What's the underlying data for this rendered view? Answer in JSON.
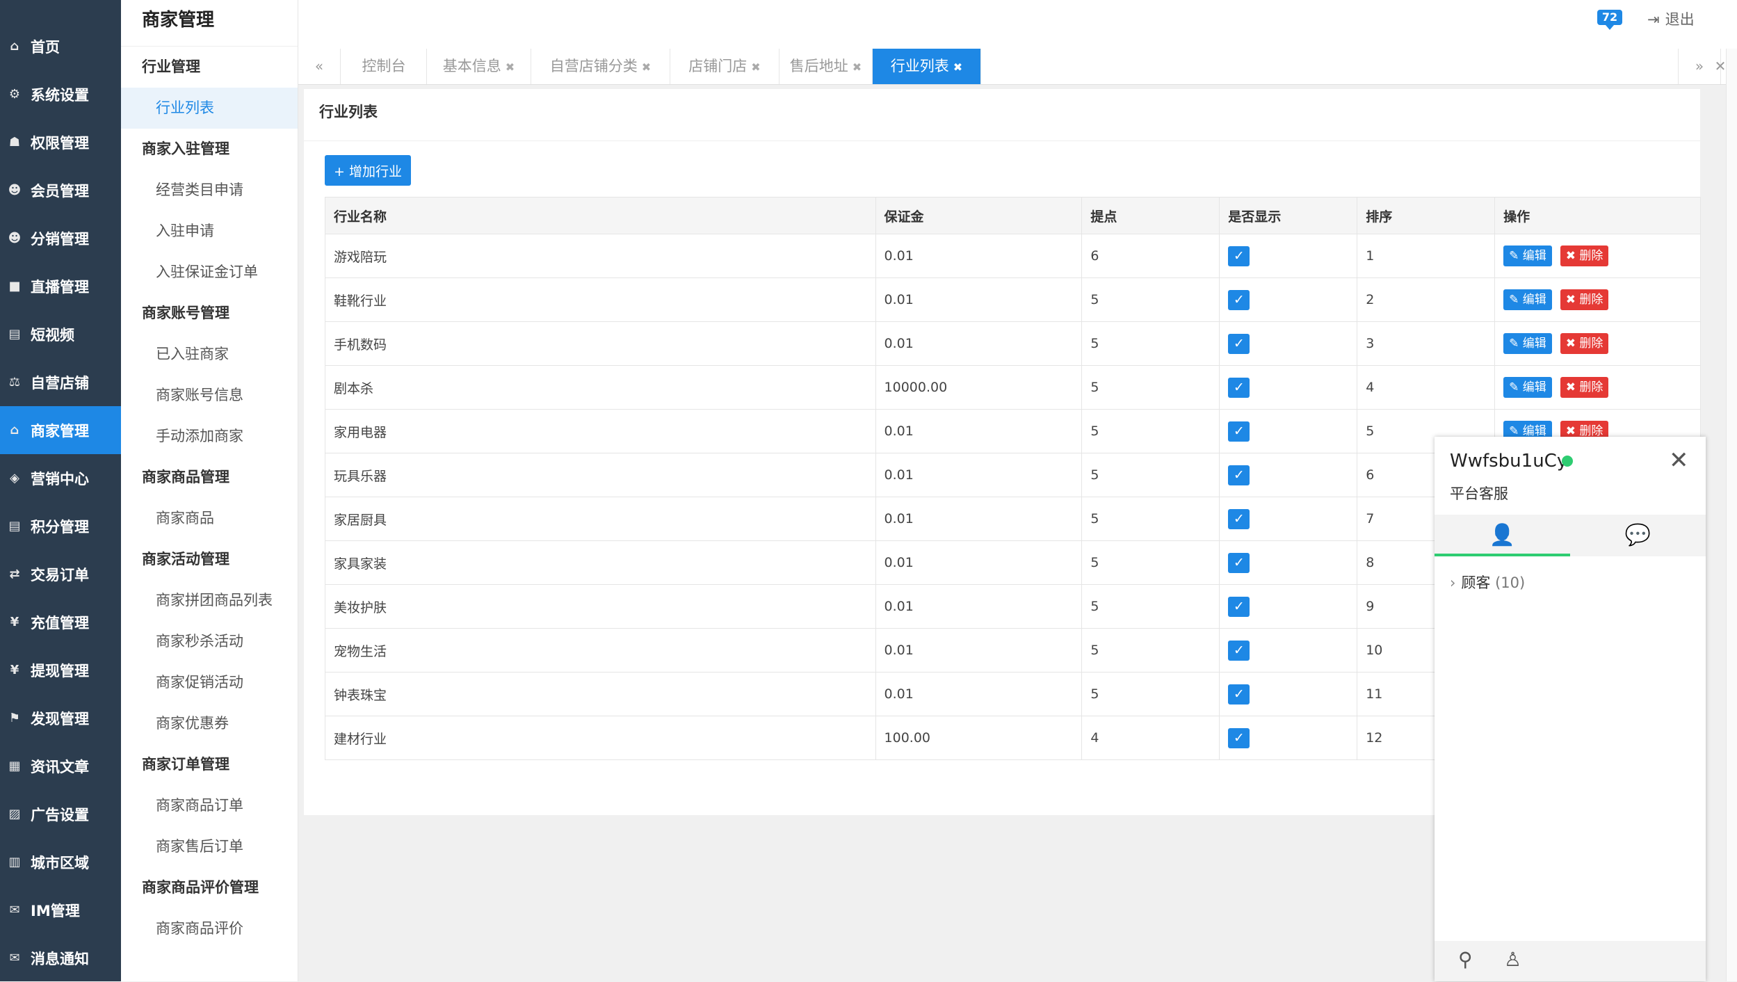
{
  "sidebar": {
    "items": [
      {
        "icon": "home-icon",
        "glyph": "⌂",
        "label": "首页"
      },
      {
        "icon": "gear-icon",
        "glyph": "⚙",
        "label": "系统设置"
      },
      {
        "icon": "sitemap-icon",
        "glyph": "☗",
        "label": "权限管理"
      },
      {
        "icon": "users-icon",
        "glyph": "☻",
        "label": "会员管理"
      },
      {
        "icon": "users-icon",
        "glyph": "☻",
        "label": "分销管理"
      },
      {
        "icon": "video-icon",
        "glyph": "■",
        "label": "直播管理"
      },
      {
        "icon": "file-icon",
        "glyph": "▤",
        "label": "短视频"
      },
      {
        "icon": "scale-icon",
        "glyph": "⚖",
        "label": "自营店铺"
      },
      {
        "icon": "bank-icon",
        "glyph": "⌂",
        "label": "商家管理"
      },
      {
        "icon": "tag-icon",
        "glyph": "◈",
        "label": "营销中心"
      },
      {
        "icon": "file-icon",
        "glyph": "▤",
        "label": "积分管理"
      },
      {
        "icon": "exchange-icon",
        "glyph": "⇄",
        "label": "交易订单"
      },
      {
        "icon": "yen-icon",
        "glyph": "¥",
        "label": "充值管理"
      },
      {
        "icon": "yen-icon",
        "glyph": "¥",
        "label": "提现管理"
      },
      {
        "icon": "flag-icon",
        "glyph": "⚑",
        "label": "发现管理"
      },
      {
        "icon": "newspaper-icon",
        "glyph": "▦",
        "label": "资讯文章"
      },
      {
        "icon": "image-icon",
        "glyph": "▨",
        "label": "广告设置"
      },
      {
        "icon": "map-icon",
        "glyph": "▥",
        "label": "城市区域"
      },
      {
        "icon": "chat-icon",
        "glyph": "✉",
        "label": "IM管理"
      },
      {
        "icon": "comment-icon",
        "glyph": "✉",
        "label": "消息通知"
      }
    ]
  },
  "submenu": {
    "title": "商家管理",
    "entries": [
      {
        "type": "group",
        "label": "行业管理"
      },
      {
        "type": "item",
        "label": "行业列表",
        "active": true
      },
      {
        "type": "group",
        "label": "商家入驻管理"
      },
      {
        "type": "item",
        "label": "经营类目申请"
      },
      {
        "type": "item",
        "label": "入驻申请"
      },
      {
        "type": "item",
        "label": "入驻保证金订单"
      },
      {
        "type": "group",
        "label": "商家账号管理"
      },
      {
        "type": "item",
        "label": "已入驻商家"
      },
      {
        "type": "item",
        "label": "商家账号信息"
      },
      {
        "type": "item",
        "label": "手动添加商家"
      },
      {
        "type": "group",
        "label": "商家商品管理"
      },
      {
        "type": "item",
        "label": "商家商品"
      },
      {
        "type": "group",
        "label": "商家活动管理"
      },
      {
        "type": "item",
        "label": "商家拼团商品列表"
      },
      {
        "type": "item",
        "label": "商家秒杀活动"
      },
      {
        "type": "item",
        "label": "商家促销活动"
      },
      {
        "type": "item",
        "label": "商家优惠券"
      },
      {
        "type": "group",
        "label": "商家订单管理"
      },
      {
        "type": "item",
        "label": "商家商品订单"
      },
      {
        "type": "item",
        "label": "商家售后订单"
      },
      {
        "type": "group",
        "label": "商家商品评价管理"
      },
      {
        "type": "item",
        "label": "商家商品评价"
      }
    ]
  },
  "header": {
    "notification_count": "72",
    "logout_label": "退出"
  },
  "tabs": {
    "items": [
      {
        "label": "控制台",
        "closable": false
      },
      {
        "label": "基本信息",
        "closable": true
      },
      {
        "label": "自营店铺分类",
        "closable": true
      },
      {
        "label": "店铺门店",
        "closable": true
      },
      {
        "label": "售后地址",
        "closable": true
      },
      {
        "label": "行业列表",
        "closable": true,
        "active": true
      }
    ]
  },
  "panel": {
    "title": "行业列表",
    "add_button": "+ 增加行业",
    "columns": [
      "行业名称",
      "保证金",
      "提点",
      "是否显示",
      "排序",
      "操作"
    ],
    "edit_label": "编辑",
    "delete_label": "删除",
    "rows": [
      {
        "name": "游戏陪玩",
        "deposit": "0.01",
        "commission": "6",
        "visible": true,
        "sort": "1"
      },
      {
        "name": "鞋靴行业",
        "deposit": "0.01",
        "commission": "5",
        "visible": true,
        "sort": "2"
      },
      {
        "name": "手机数码",
        "deposit": "0.01",
        "commission": "5",
        "visible": true,
        "sort": "3"
      },
      {
        "name": "剧本杀",
        "deposit": "10000.00",
        "commission": "5",
        "visible": true,
        "sort": "4"
      },
      {
        "name": "家用电器",
        "deposit": "0.01",
        "commission": "5",
        "visible": true,
        "sort": "5"
      },
      {
        "name": "玩具乐器",
        "deposit": "0.01",
        "commission": "5",
        "visible": true,
        "sort": "6"
      },
      {
        "name": "家居厨具",
        "deposit": "0.01",
        "commission": "5",
        "visible": true,
        "sort": "7"
      },
      {
        "name": "家具家装",
        "deposit": "0.01",
        "commission": "5",
        "visible": true,
        "sort": "8"
      },
      {
        "name": "美妆护肤",
        "deposit": "0.01",
        "commission": "5",
        "visible": true,
        "sort": "9"
      },
      {
        "name": "宠物生活",
        "deposit": "0.01",
        "commission": "5",
        "visible": true,
        "sort": "10"
      },
      {
        "name": "钟表珠宝",
        "deposit": "0.01",
        "commission": "5",
        "visible": true,
        "sort": "11"
      },
      {
        "name": "建材行业",
        "deposit": "100.00",
        "commission": "4",
        "visible": true,
        "sort": "12"
      }
    ]
  },
  "chat": {
    "username": "Wwfsbu1uCy",
    "role": "平台客服",
    "group_label": "顾客",
    "group_count": "(10)"
  },
  "colors": {
    "sidebar_bg": "#2c3d4f",
    "accent": "#1e88e5",
    "danger": "#e53935",
    "online": "#2ecc71"
  }
}
